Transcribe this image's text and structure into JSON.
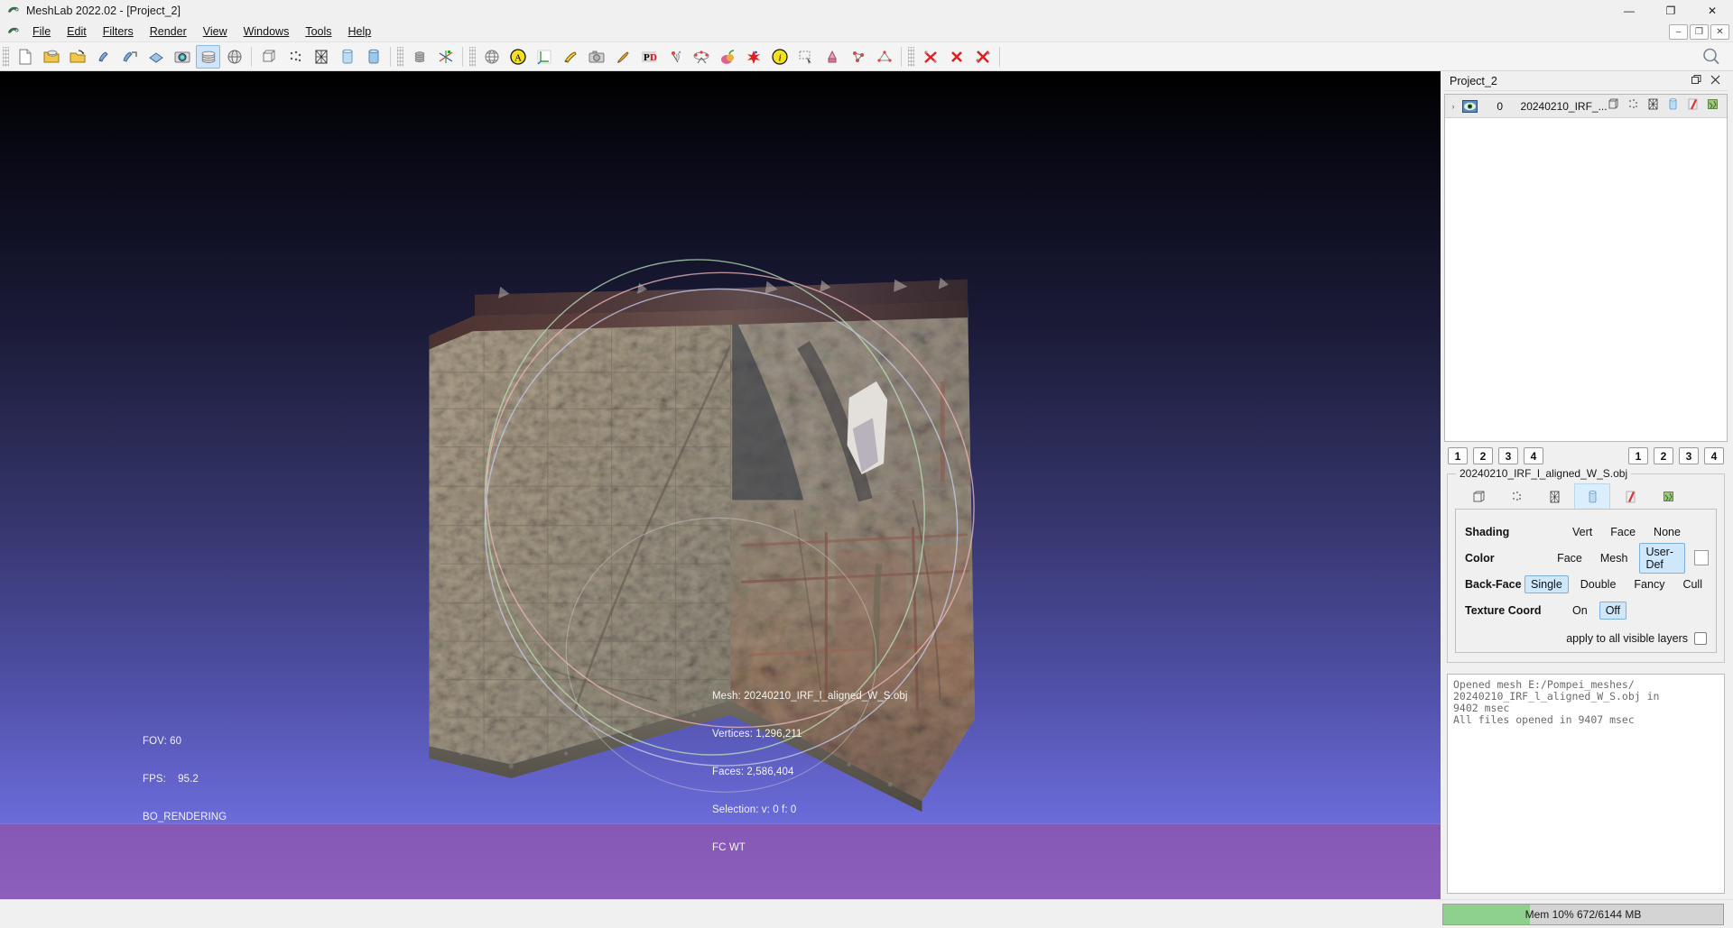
{
  "window": {
    "title": "MeshLab 2022.02 - [Project_2]",
    "app_icon": "meshlab-logo-icon",
    "controls": [
      {
        "name": "minimize-button",
        "glyph": "—"
      },
      {
        "name": "restore-button",
        "glyph": "❐"
      },
      {
        "name": "close-button",
        "glyph": "✕"
      }
    ]
  },
  "menubar": {
    "icon": "meshlab-logo-icon",
    "items": [
      {
        "label": "File",
        "mnemonic": "F"
      },
      {
        "label": "Edit",
        "mnemonic": "E"
      },
      {
        "label": "Filters",
        "mnemonic": "l"
      },
      {
        "label": "Render",
        "mnemonic": "R"
      },
      {
        "label": "View",
        "mnemonic": "V"
      },
      {
        "label": "Windows",
        "mnemonic": "W"
      },
      {
        "label": "Tools",
        "mnemonic": "T"
      },
      {
        "label": "Help",
        "mnemonic": "H"
      }
    ],
    "mdi_controls": [
      {
        "name": "mdi-minimize-button",
        "glyph": "–"
      },
      {
        "name": "mdi-restore-button",
        "glyph": "❐"
      },
      {
        "name": "mdi-close-button",
        "glyph": "✕"
      }
    ]
  },
  "toolbar": {
    "search_icon": "search-icon",
    "groups": [
      {
        "items": [
          {
            "name": "new-project-icon",
            "tip": "New Empty Project"
          },
          {
            "name": "open-project-icon",
            "tip": "Open Project"
          },
          {
            "name": "open-mesh-icon",
            "tip": "Import Mesh"
          },
          {
            "name": "save-project-icon",
            "tip": "Save Project"
          },
          {
            "name": "save-mesh-icon",
            "tip": "Export Mesh"
          },
          {
            "name": "reload-icon",
            "tip": "Reload"
          },
          {
            "name": "snapshot-icon",
            "tip": "Take Snapshot"
          },
          {
            "name": "show-layer-dialog-icon",
            "tip": "Show Layer Dialog",
            "active": true
          },
          {
            "name": "show-trackball-icon",
            "tip": "Show Trackball"
          },
          {
            "name": "reset-trackball-icon",
            "tip": "Reset Trackball"
          },
          {
            "name": "vertex-points-icon",
            "tip": "Points"
          },
          {
            "name": "wireframe-icon",
            "tip": "Wireframe"
          },
          {
            "name": "flat-lines-icon",
            "tip": "Flat Lines"
          },
          {
            "name": "smooth-shading-icon",
            "tip": "Smooth"
          }
        ]
      },
      {
        "items": [
          {
            "name": "layer-stack-icon",
            "tip": "Layers"
          },
          {
            "name": "align-axes-icon",
            "tip": "Align Tool"
          }
        ]
      },
      {
        "items": [
          {
            "name": "globe-icon",
            "tip": "Sphere Parametrization"
          },
          {
            "name": "annotation-a-icon",
            "tip": "Annotation"
          },
          {
            "name": "measure-axis-icon",
            "tip": "Measuring Tool"
          },
          {
            "name": "get-info-pencil-icon",
            "tip": "Edit Tool"
          },
          {
            "name": "camera-icon",
            "tip": "Camera"
          },
          {
            "name": "paint-brush-icon",
            "tip": "Z-Painting"
          },
          {
            "name": "pdf-export-icon",
            "tip": "Export PDF"
          },
          {
            "name": "point-picker-icon",
            "tip": "Pick Points"
          },
          {
            "name": "align-pairs-icon",
            "tip": "Align Pairs"
          },
          {
            "name": "segment-color-icon",
            "tip": "Segmentation"
          },
          {
            "name": "delete-star-icon",
            "tip": "Remove Selection"
          },
          {
            "name": "info-icon",
            "tip": "Get Info"
          },
          {
            "name": "select-rect-icon",
            "tip": "Select Faces in Rect"
          },
          {
            "name": "select-paint-icon",
            "tip": "Select by Painting"
          },
          {
            "name": "select-connected-icon",
            "tip": "Select Connected"
          },
          {
            "name": "select-vertex-icon",
            "tip": "Select Vertexes"
          }
        ]
      },
      {
        "items": [
          {
            "name": "delete-selected-faces-icon",
            "tip": "Delete Selected Faces"
          },
          {
            "name": "delete-selected-vertices-icon",
            "tip": "Delete Selected Vertices"
          },
          {
            "name": "delete-selected-all-icon",
            "tip": "Delete Selected Faces and Vertices"
          }
        ]
      }
    ]
  },
  "viewport": {
    "background_top": "#000000",
    "background_bottom": "#7a7ae8",
    "trackball_visible": true,
    "overlay_left": [
      "FOV: 60",
      "FPS:    95.2",
      "BO_RENDERING"
    ],
    "overlay_info": [
      "Mesh: 20240210_IRF_l_aligned_W_S.obj",
      "Vertices: 1,296,211",
      "Faces: 2,586,404",
      "Selection: v: 0 f: 0",
      "FC WT"
    ],
    "band_color": "#a0469680"
  },
  "dock": {
    "title": "Project_2",
    "float_icon": "float-window-icon",
    "close_icon": "close-icon",
    "layers": {
      "columns": [
        "visibility",
        "id",
        "name"
      ],
      "rows": [
        {
          "expander": "›",
          "visible": true,
          "id": "0",
          "name": "20240210_IRF_...",
          "icons": [
            "bbox-icon",
            "points-icon",
            "wireframe-icon",
            "flat-icon",
            "smooth-icon",
            "texture-icon"
          ]
        }
      ]
    },
    "view_buttons_left": [
      "1",
      "2",
      "3",
      "4"
    ],
    "view_buttons_right": [
      "1",
      "2",
      "3",
      "4"
    ],
    "render_group": {
      "legend": "20240210_IRF_l_aligned_W_S.obj",
      "tabs": [
        {
          "name": "bbox-tab-icon",
          "selected": false
        },
        {
          "name": "points-tab-icon",
          "selected": false
        },
        {
          "name": "wireframe-tab-icon",
          "selected": false
        },
        {
          "name": "solid-tab-icon",
          "selected": true
        },
        {
          "name": "texture-tab-icon",
          "selected": false
        },
        {
          "name": "shader-tab-icon",
          "selected": false
        }
      ],
      "properties": [
        {
          "label": "Shading",
          "options": [
            {
              "text": "Vert",
              "selected": false
            },
            {
              "text": "Face",
              "selected": false
            },
            {
              "text": "None",
              "selected": false
            }
          ]
        },
        {
          "label": "Color",
          "options": [
            {
              "text": "Face",
              "selected": false
            },
            {
              "text": "Mesh",
              "selected": false
            },
            {
              "text": "User-Def",
              "selected": true
            }
          ],
          "swatch": "#ffffff"
        },
        {
          "label": "Back-Face",
          "options": [
            {
              "text": "Single",
              "selected": true
            },
            {
              "text": "Double",
              "selected": false
            },
            {
              "text": "Fancy",
              "selected": false
            },
            {
              "text": "Cull",
              "selected": false
            }
          ]
        },
        {
          "label": "Texture Coord",
          "options": [
            {
              "text": "On",
              "selected": false
            },
            {
              "text": "Off",
              "selected": true
            }
          ]
        }
      ],
      "apply_all_label": "apply to all visible layers",
      "apply_all_checked": false
    },
    "log": "Opened mesh E:/Pompei_meshes/\n20240210_IRF_l_aligned_W_S.obj in\n9402 msec\nAll files opened in 9407 msec"
  },
  "statusbar": {
    "memory": {
      "text": "Mem 10% 672/6144 MB",
      "percent": 10,
      "fill_color": "#8dd18d"
    }
  }
}
